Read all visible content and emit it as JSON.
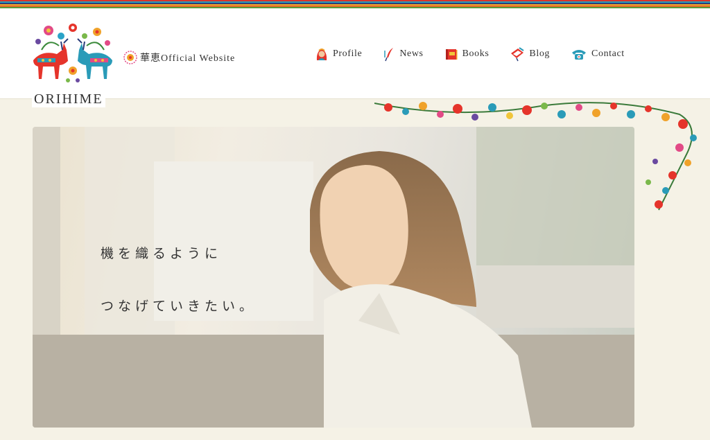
{
  "site": {
    "logo_text": "ORIHIME",
    "label": "華恵Official Website"
  },
  "nav": [
    {
      "label": "Profile",
      "icon": "woman-portrait-icon"
    },
    {
      "label": "News",
      "icon": "quill-pen-icon"
    },
    {
      "label": "Books",
      "icon": "book-icon"
    },
    {
      "label": "Blog",
      "icon": "notebook-pencil-icon"
    },
    {
      "label": "Contact",
      "icon": "telephone-icon"
    }
  ],
  "hero": {
    "line1": "機を織るように",
    "line2": "つなげていきたい。"
  },
  "colors": {
    "stripe": [
      "#d6342c",
      "#f0a22a",
      "#2a9bb8",
      "#2b3d7a",
      "#e06a2a",
      "#5a9a3a"
    ],
    "background": "#f5f2e6",
    "text": "#333333"
  }
}
